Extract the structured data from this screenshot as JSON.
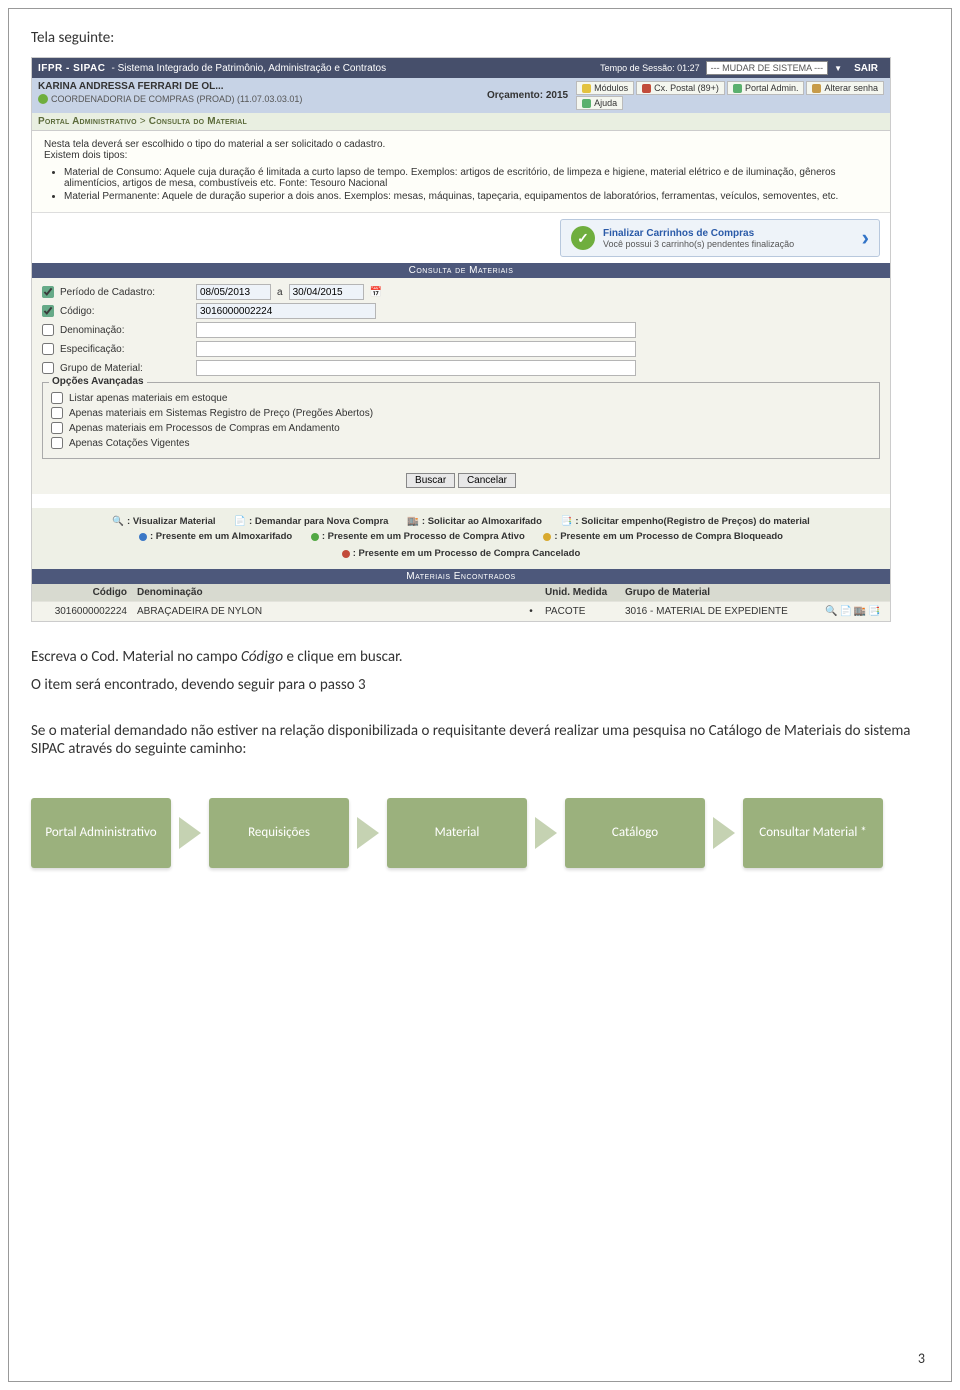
{
  "heading": "Tela seguinte:",
  "shot": {
    "top": {
      "app": "IFPR - SIPAC",
      "sub": "- Sistema Integrado de Patrimônio, Administração e Contratos",
      "session": "Tempo de Sessão: 01:27",
      "sysbox": "--- MUDAR DE SISTEMA ---",
      "sair": "SAIR"
    },
    "sub": {
      "user": "KARINA ANDRESSA FERRARI DE OL...",
      "org": "COORDENADORIA DE COMPRAS (PROAD) (11.07.03.03.01)",
      "orc": "Orçamento: 2015",
      "b_mod": "Módulos",
      "b_cxp": "Cx. Postal (89+)",
      "b_port": "Portal Admin.",
      "b_alt": "Alterar senha",
      "b_ajuda": "Ajuda"
    },
    "bc": {
      "a": "Portal Administrativo",
      "b": "Consulta do Material"
    },
    "info": {
      "p1": "Nesta tela deverá ser escolhido o tipo do material a ser solicitado o cadastro.",
      "p2": "Existem dois tipos:",
      "li1": "Material de Consumo: Aquele cuja duração é limitada a curto lapso de tempo. Exemplos: artigos de escritório, de limpeza e higiene, material elétrico e de iluminação, gêneros alimentícios, artigos de mesa, combustíveis etc. Fonte: Tesouro Nacional",
      "li2": "Material Permanente: Aquele de duração superior a dois anos. Exemplos: mesas, máquinas, tapeçaria, equipamentos de laboratórios, ferramentas, veículos, semoventes, etc."
    },
    "cart": {
      "title": "Finalizar Carrinhos de Compras",
      "sub": "Você possui 3 carrinho(s) pendentes finalização"
    },
    "barConsulta": "Consulta de Materiais",
    "form": {
      "l_periodo": "Período de Cadastro:",
      "v_periodo_a": "08/05/2013",
      "sep": "a",
      "v_periodo_b": "30/04/2015",
      "l_cod": "Código:",
      "v_cod": "3016000002224",
      "l_den": "Denominação:",
      "l_esp": "Especificação:",
      "l_grp": "Grupo de Material:",
      "opcoes": "Opções Avançadas",
      "o1": "Listar apenas materiais em estoque",
      "o2": "Apenas materiais em Sistemas Registro de Preço (Pregões Abertos)",
      "o3": "Apenas materiais em Processos de Compras em Andamento",
      "o4": "Apenas Cotações Vigentes",
      "buscar": "Buscar",
      "cancelar": "Cancelar"
    },
    "legend": {
      "a": ": Visualizar Material",
      "b": ": Demandar para Nova Compra",
      "c": ": Solicitar ao Almoxarifado",
      "d": ": Solicitar empenho(Registro de Preços) do material",
      "e": ": Presente em um Almoxarifado",
      "f": ": Presente em um Processo de Compra Ativo",
      "g": ": Presente em um Processo de Compra Bloqueado",
      "h": ": Presente em um Processo de Compra Cancelado"
    },
    "barResult": "Materiais Encontrados",
    "table": {
      "h_cod": "Código",
      "h_den": "Denominação",
      "h_um": "Unid. Medida",
      "h_grp": "Grupo de Material",
      "row": {
        "cod": "3016000002224",
        "den": "ABRAÇADEIRA DE NYLON",
        "star": "•",
        "um": "PACOTE",
        "grp": "3016 - MATERIAL DE EXPEDIENTE"
      }
    }
  },
  "body": {
    "p1a": "Escreva o Cod. Material no campo ",
    "p1b": "Código",
    "p1c": " e clique em buscar.",
    "p2": "O item será encontrado, devendo seguir para o passo 3",
    "p3": "Se o material demandado não estiver na relação disponibilizada o requisitante deverá realizar uma pesquisa no Catálogo de Materiais do sistema SIPAC através do seguinte caminho:"
  },
  "flow": {
    "s1": "Portal Administrativo",
    "s2": "Requisições",
    "s3": "Material",
    "s4": "Catálogo",
    "s5": "Consultar Material *"
  },
  "page_number": "3"
}
